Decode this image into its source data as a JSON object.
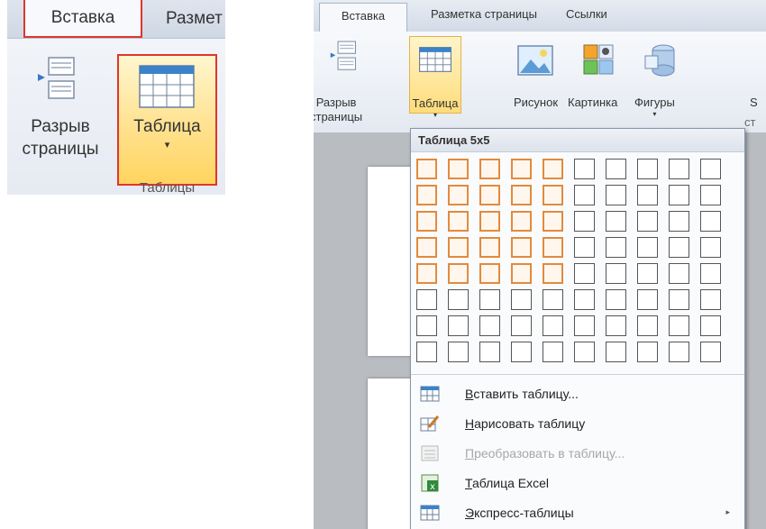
{
  "left_panel": {
    "tabs": {
      "insert": "Вставка",
      "page_layout_partial": "Размет"
    },
    "page_break": {
      "line1": "Разрыв",
      "line2": "страницы"
    },
    "table_button": {
      "label": "Таблица",
      "arrow": "▾"
    },
    "group_label": "Таблицы"
  },
  "right_panel": {
    "tabs": [
      "Вставка",
      "Разметка страницы",
      "Ссылки"
    ],
    "ribbon": {
      "page_break": {
        "line1": "Разрыв",
        "line2": "страницы"
      },
      "table": {
        "label": "Таблица",
        "arrow": "▾"
      },
      "picture": "Рисунок",
      "clipart": "Картинка",
      "shapes": {
        "label": "Фигуры",
        "arrow": "▾"
      },
      "smartart_partial": "S",
      "cut_letters": "ст"
    },
    "dropdown": {
      "header": "Таблица 5x5",
      "grid": {
        "columns": 10,
        "rows": 8,
        "selected_cols": 5,
        "selected_rows": 5
      },
      "menu": [
        {
          "prefix": "",
          "accel": "В",
          "rest": "ставить таблицу...",
          "icon": "insert-table-icon",
          "disabled": false,
          "submenu": false
        },
        {
          "prefix": "",
          "accel": "Н",
          "rest": "арисовать таблицу",
          "icon": "draw-table-icon",
          "disabled": false,
          "submenu": false
        },
        {
          "prefix": "",
          "accel": "П",
          "rest": "реобразовать в таблицу...",
          "icon": "convert-table-icon",
          "disabled": true,
          "submenu": false
        },
        {
          "prefix": "",
          "accel": "Т",
          "rest": "аблица Excel",
          "icon": "excel-table-icon",
          "disabled": false,
          "submenu": false
        },
        {
          "prefix": "",
          "accel": "Э",
          "rest": "кспресс-таблицы",
          "icon": "quick-tables-icon",
          "disabled": false,
          "submenu": true,
          "arrow": "▸"
        }
      ]
    }
  },
  "colors": {
    "highlight_red": "#e0362b",
    "grid_selected": "#e38a3c",
    "ribbon_active": "#ffdc7a"
  }
}
